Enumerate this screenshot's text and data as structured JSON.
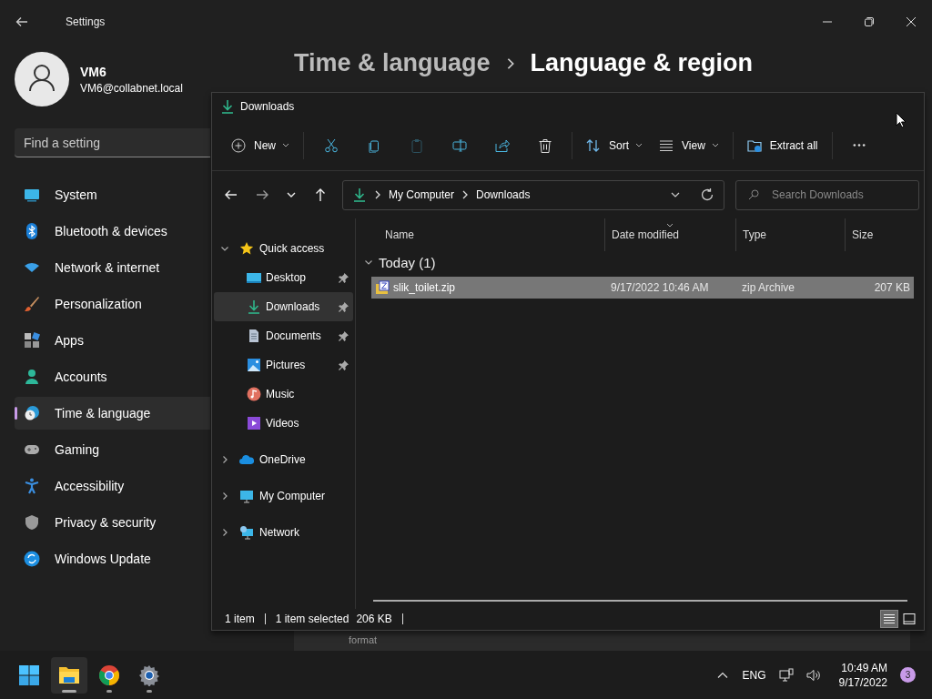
{
  "settings": {
    "title": "Settings",
    "user": {
      "name": "VM6",
      "email": "VM6@collabnet.local"
    },
    "search": {
      "placeholder": "Find a setting"
    },
    "nav": [
      {
        "label": "System",
        "kind": "system",
        "selected": false
      },
      {
        "label": "Bluetooth & devices",
        "kind": "bluetooth",
        "selected": false
      },
      {
        "label": "Network & internet",
        "kind": "network",
        "selected": false
      },
      {
        "label": "Personalization",
        "kind": "personalization",
        "selected": false
      },
      {
        "label": "Apps",
        "kind": "apps",
        "selected": false
      },
      {
        "label": "Accounts",
        "kind": "accounts",
        "selected": false
      },
      {
        "label": "Time & language",
        "kind": "time",
        "selected": true
      },
      {
        "label": "Gaming",
        "kind": "gaming",
        "selected": false
      },
      {
        "label": "Accessibility",
        "kind": "accessibility",
        "selected": false
      },
      {
        "label": "Privacy & security",
        "kind": "privacy",
        "selected": false
      },
      {
        "label": "Windows Update",
        "kind": "update",
        "selected": false
      }
    ],
    "breadcrumb": {
      "parent": "Time & language",
      "current": "Language & region"
    },
    "card_text": "format"
  },
  "explorer": {
    "title": "Downloads",
    "toolbar": [
      {
        "kind": "new",
        "label": "New"
      },
      {
        "kind": "separator"
      },
      {
        "kind": "cut",
        "disabled": false
      },
      {
        "kind": "copy",
        "disabled": false
      },
      {
        "kind": "paste",
        "disabled": true
      },
      {
        "kind": "rename",
        "disabled": false
      },
      {
        "kind": "share",
        "disabled": false
      },
      {
        "kind": "delete",
        "disabled": false
      },
      {
        "kind": "separator"
      },
      {
        "kind": "sort",
        "label": "Sort"
      },
      {
        "kind": "view",
        "label": "View"
      },
      {
        "kind": "separator"
      },
      {
        "kind": "extract",
        "label": "Extract all"
      },
      {
        "kind": "separator"
      },
      {
        "kind": "more"
      }
    ],
    "address": [
      "My Computer",
      "Downloads"
    ],
    "search": {
      "placeholder": "Search Downloads"
    },
    "tree": [
      {
        "label": "Quick access",
        "kind": "quick",
        "expanded": true,
        "selected": false,
        "children": [
          {
            "label": "Desktop",
            "kind": "desktop",
            "pinned": true,
            "selected": false
          },
          {
            "label": "Downloads",
            "kind": "downloads",
            "pinned": true,
            "selected": true
          },
          {
            "label": "Documents",
            "kind": "documents",
            "pinned": true,
            "selected": false
          },
          {
            "label": "Pictures",
            "kind": "pictures",
            "pinned": true,
            "selected": false
          },
          {
            "label": "Music",
            "kind": "music",
            "pinned": false,
            "selected": false
          },
          {
            "label": "Videos",
            "kind": "videos",
            "pinned": false,
            "selected": false
          }
        ]
      },
      {
        "label": "OneDrive",
        "kind": "onedrive",
        "expanded": false,
        "selected": false
      },
      {
        "label": "My Computer",
        "kind": "computer",
        "expanded": false,
        "selected": false
      },
      {
        "label": "Network",
        "kind": "network",
        "expanded": false,
        "selected": false
      }
    ],
    "columns": [
      "Name",
      "Date modified",
      "Type",
      "Size"
    ],
    "groups": [
      {
        "label": "Today (1)",
        "expanded": true,
        "rows": [
          {
            "name": "slik_toilet.zip",
            "date": "9/17/2022 10:46 AM",
            "type": "zip Archive",
            "size": "207 KB",
            "selected": true
          }
        ]
      }
    ],
    "status": [
      "1 item",
      "1 item selected",
      "206 KB"
    ],
    "view_modes": [
      {
        "kind": "details",
        "selected": true
      },
      {
        "kind": "tiles",
        "selected": false
      }
    ]
  },
  "taskbar": {
    "apps": [
      {
        "kind": "start",
        "active": false,
        "running": false
      },
      {
        "kind": "explorer",
        "active": true,
        "running": true
      },
      {
        "kind": "chrome",
        "active": false,
        "running": true
      },
      {
        "kind": "settings",
        "active": false,
        "running": true
      }
    ],
    "language": "ENG",
    "time": "10:49 AM",
    "date": "9/17/2022",
    "notifications": "3"
  }
}
